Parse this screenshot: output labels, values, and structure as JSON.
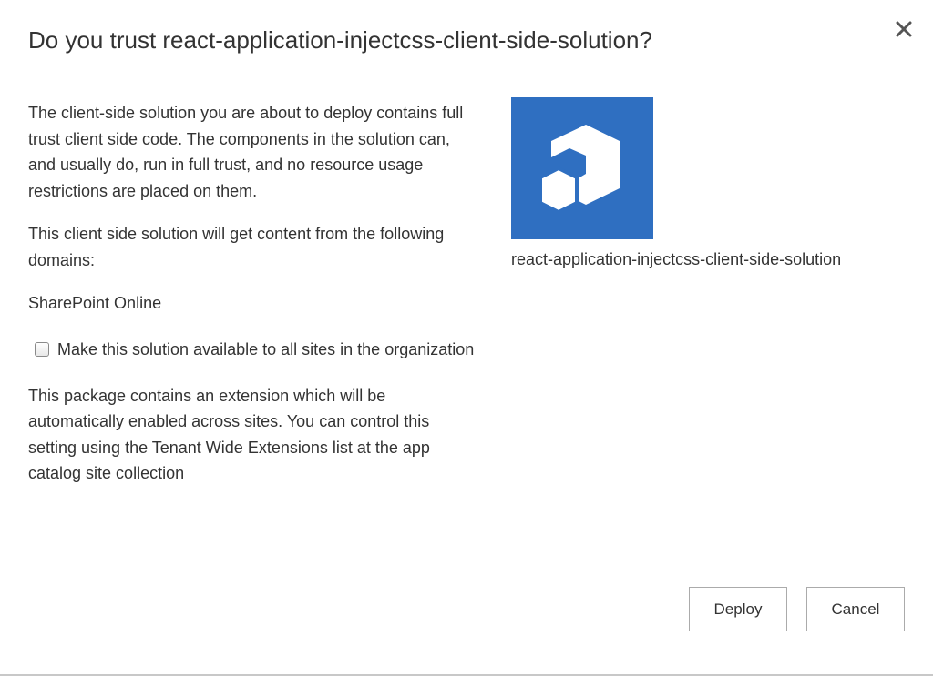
{
  "dialog": {
    "title": "Do you trust react-application-injectcss-client-side-solution?",
    "close_icon": "close-icon"
  },
  "content": {
    "description": "The client-side solution you are about to deploy contains full trust client side code. The components in the solution can, and usually do, run in full trust, and no resource usage restrictions are placed on them.",
    "domains_intro": "This client side solution will get content from the following domains:",
    "domains": [
      "SharePoint Online"
    ],
    "checkbox": {
      "label": "Make this solution available to all sites in the organization",
      "checked": false
    },
    "extension_note": "This package contains an extension which will be automatically enabled across sites. You can control this setting using the Tenant Wide Extensions list at the app catalog site collection"
  },
  "app": {
    "icon": "app-package-icon",
    "name": "react-application-injectcss-client-side-solution",
    "tile_color": "#2f6fc1"
  },
  "buttons": {
    "deploy_label": "Deploy",
    "cancel_label": "Cancel"
  }
}
